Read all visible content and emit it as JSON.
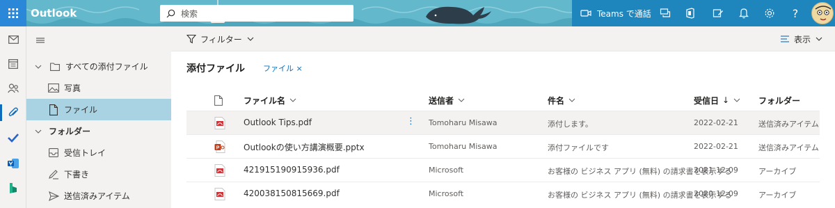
{
  "header": {
    "app_name": "Outlook",
    "search_placeholder": "検索",
    "teams_call_label": "Teams で通話"
  },
  "folder_pane": {
    "items": [
      {
        "label": "すべての添付ファイル",
        "icon": "folder-icon",
        "expand": "chevron-down-icon"
      },
      {
        "label": "写真",
        "icon": "image-icon"
      },
      {
        "label": "ファイル",
        "icon": "document-icon",
        "selected": true
      },
      {
        "label": "フォルダー",
        "expand": "chevron-down-icon",
        "section": true
      },
      {
        "label": "受信トレイ",
        "icon": "inbox-icon"
      },
      {
        "label": "下書き",
        "icon": "draft-icon"
      },
      {
        "label": "送信済みアイテム",
        "icon": "send-icon"
      }
    ]
  },
  "commandbar": {
    "filter_label": "フィルター",
    "view_label": "表示"
  },
  "main": {
    "title": "添付ファイル",
    "chip_label": "ファイル ×",
    "columns": {
      "filename": "ファイル名",
      "sender": "送信者",
      "subject": "件名",
      "received": "受信日",
      "folder": "フォルダー"
    },
    "rows": [
      {
        "name": "Outlook Tips.pdf",
        "type": "pdf",
        "sender": "Tomoharu Misawa",
        "subject": "添付します。",
        "date": "2022-02-21",
        "folder": "送信済みアイテム"
      },
      {
        "name": "Outlookの使い方講演概要.pptx",
        "type": "pptx",
        "sender": "Tomoharu Misawa",
        "subject": "添付ファイルです",
        "date": "2022-02-21",
        "folder": "送信済みアイテム"
      },
      {
        "name": "421915190915936.pdf",
        "type": "pdf",
        "sender": "Microsoft",
        "subject": "お客様の ビジネス アプリ (無料) の請求書を表示する",
        "date": "2021-12-09",
        "folder": "アーカイブ"
      },
      {
        "name": "420038150815669.pdf",
        "type": "pdf",
        "sender": "Microsoft",
        "subject": "お客様の ビジネス アプリ (無料) の請求書を表示する",
        "date": "2020-12-09",
        "folder": "アーカイブ"
      }
    ]
  },
  "colors": {
    "header_bg": "#5fb4c9",
    "header_right_bg": "#1f85bd",
    "accent": "#0f6cbd",
    "selected_folder": "#a9d3e2",
    "pdf_red": "#d13438"
  }
}
